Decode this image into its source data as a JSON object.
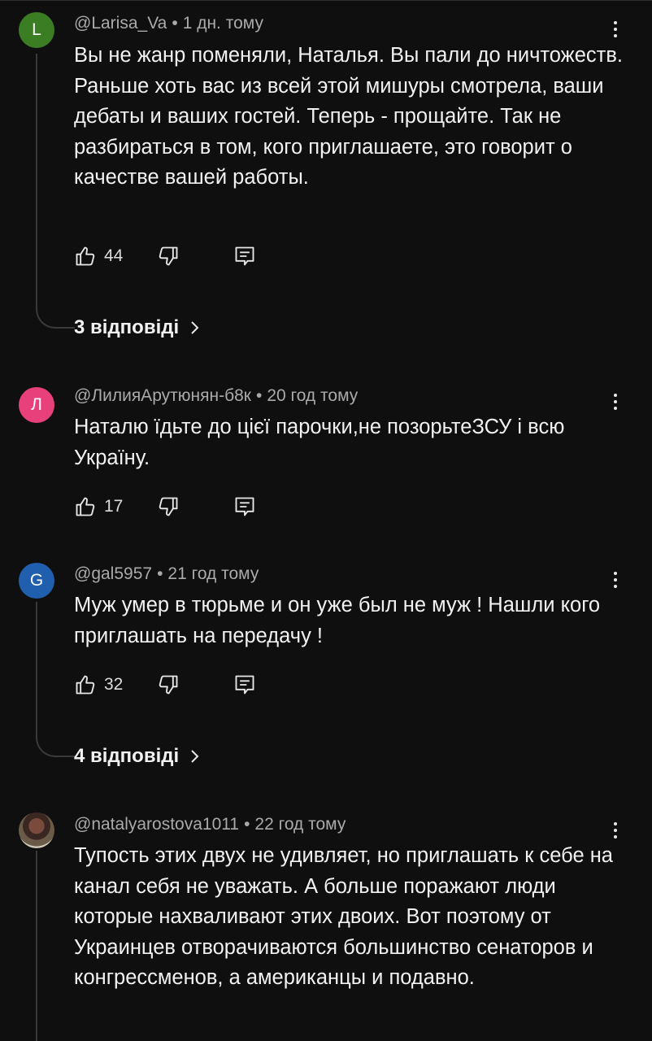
{
  "comments": [
    {
      "avatar_letter": "L",
      "avatar_color": "#3b7d23",
      "author": "@Larisa_Va",
      "time": "1 дн. тому",
      "text": "Вы не жанр поменяли, Наталья. Вы пали до ничтожеств. Раньше хоть вас из всей этой мишуры смотрела, ваши дебаты и ваших гостей. Теперь - прощайте. Так не разбираться в том, кого приглашаете, это говорит о качестве вашей работы.",
      "likes": "44",
      "replies": "3 відповіді"
    },
    {
      "avatar_letter": "Л",
      "avatar_color": "#e8407b",
      "author": "@ЛилияАрутюнян-б8к",
      "time": "20 год тому",
      "text": "Наталю їдьте до цієї парочки,не позорьтеЗСУ і всю Україну.",
      "likes": "17"
    },
    {
      "avatar_letter": "G",
      "avatar_color": "#1f5fae",
      "author": "@gal5957",
      "time": "21 год тому",
      "text": "Муж умер в тюрьме и он уже был не муж ! Нашли кого приглашать на передачу !",
      "likes": "32",
      "replies": "4 відповіді"
    },
    {
      "avatar_letter": "",
      "author": "@natalyarostova1011",
      "time": "22 год тому",
      "text": "Тупость этих двух не удивляет, но приглашать к себе на канал себя не уважать. А больше поражают люди которые нахваливают этих двоих. Вот поэтому от Украинцев отворачиваются большинство сенаторов и конгрессменов, а американцы и подавно."
    }
  ],
  "icons": {
    "like": "thumbs-up-icon",
    "dislike": "thumbs-down-icon",
    "reply": "reply-icon",
    "more": "more-vert-icon",
    "chevron": "chevron-right-icon"
  }
}
